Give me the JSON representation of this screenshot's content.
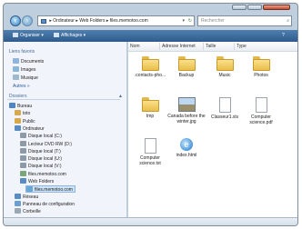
{
  "address": {
    "path": [
      "Ordinateur",
      "Web Folders",
      "files.memotoo.com"
    ]
  },
  "search": {
    "placeholder": "Rechercher"
  },
  "toolbar": {
    "organize": "Organiser",
    "views": "Affichages"
  },
  "nav": {
    "favorites_title": "Liens favoris",
    "favorites": [
      "Documents",
      "Images",
      "Musique"
    ],
    "more": "Autres",
    "folders_title": "Dossiers",
    "tree": [
      {
        "label": "Bureau",
        "indent": 0
      },
      {
        "label": "toto",
        "indent": 1
      },
      {
        "label": "Public",
        "indent": 1
      },
      {
        "label": "Ordinateur",
        "indent": 1
      },
      {
        "label": "Disque local (C:)",
        "indent": 2
      },
      {
        "label": "Lecteur DVD RW (D:)",
        "indent": 2
      },
      {
        "label": "Disque local (T:)",
        "indent": 2
      },
      {
        "label": "Disque local (U:)",
        "indent": 2
      },
      {
        "label": "Disque local (V:)",
        "indent": 2
      },
      {
        "label": "files.memotoo.com",
        "indent": 2
      },
      {
        "label": "Web Folders",
        "indent": 2
      },
      {
        "label": "files.memotoo.com",
        "indent": 3,
        "selected": true
      },
      {
        "label": "Réseau",
        "indent": 1
      },
      {
        "label": "Panneau de configuration",
        "indent": 1
      },
      {
        "label": "Corbeille",
        "indent": 1
      }
    ]
  },
  "columns": [
    "Nom",
    "Adresse Internet",
    "Taille",
    "Type"
  ],
  "items": [
    {
      "name": ".contacts-pho...",
      "type": "folder"
    },
    {
      "name": "Backup",
      "type": "folder"
    },
    {
      "name": "Music",
      "type": "folder"
    },
    {
      "name": "Photos",
      "type": "folder"
    },
    {
      "name": "tmp",
      "type": "folder"
    },
    {
      "name": "Canada before the winter.jpg",
      "type": "image"
    },
    {
      "name": "Classeur1.xls",
      "type": "doc"
    },
    {
      "name": "Computer science.pdf",
      "type": "doc"
    },
    {
      "name": "Computer science.txt",
      "type": "doc"
    },
    {
      "name": "index.html",
      "type": "ie"
    }
  ]
}
